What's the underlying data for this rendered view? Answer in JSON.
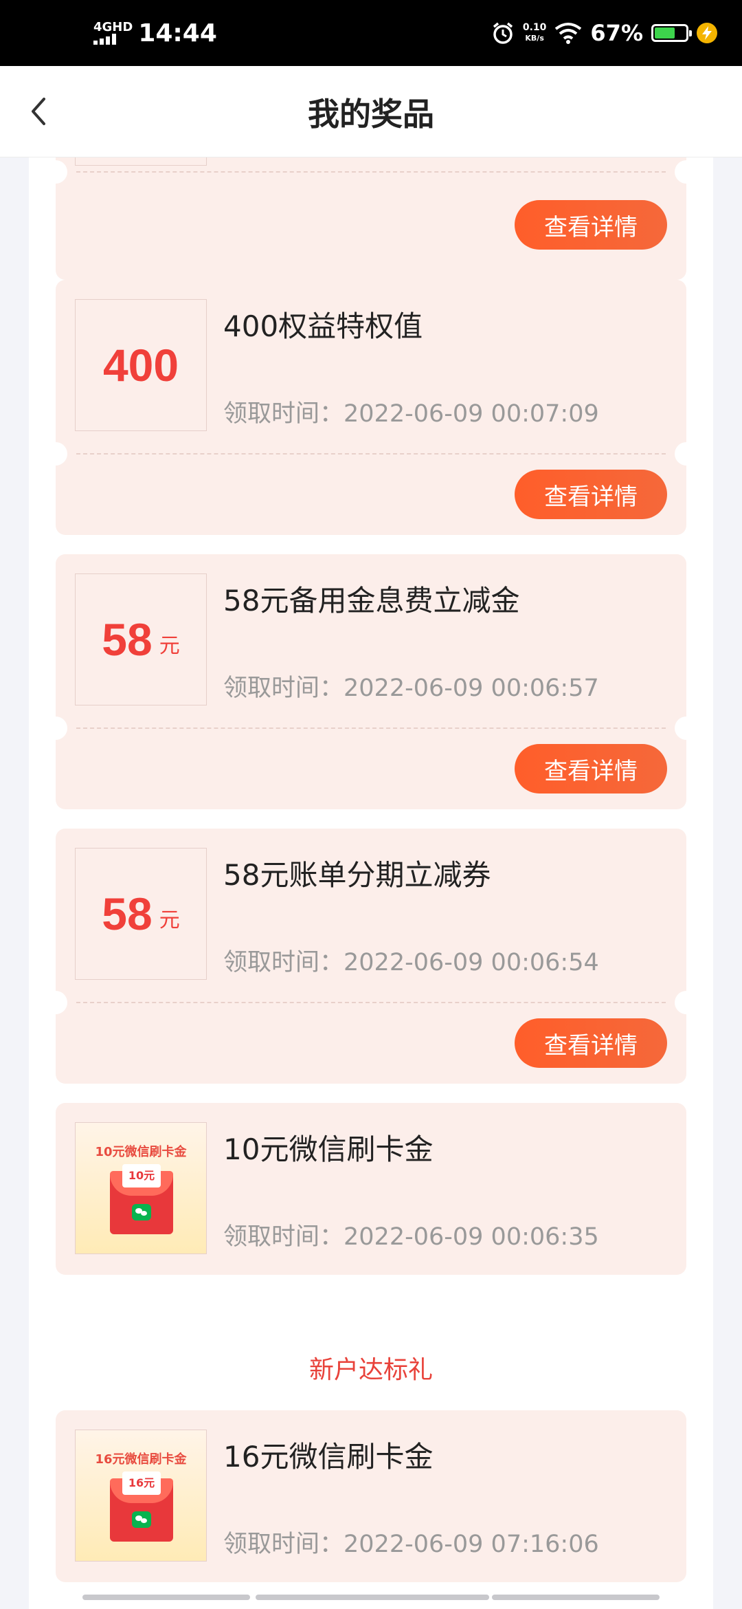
{
  "status": {
    "network": "4GHD",
    "time": "14:44",
    "speed_value": "0.10",
    "speed_unit": "KB/s",
    "battery_percent": "67%",
    "battery_level": 0.67
  },
  "nav": {
    "title": "我的奖品"
  },
  "prizes": [
    {
      "name": "400权益特权值",
      "amount": "400",
      "unit": "",
      "time_label": "领取时间：",
      "time": "2022-06-09 00:07:09",
      "button": "查看详情"
    },
    {
      "name": "58元备用金息费立减金",
      "amount": "58",
      "unit": "元",
      "time_label": "领取时间：",
      "time": "2022-06-09 00:06:57",
      "button": "查看详情"
    },
    {
      "name": "58元账单分期立减券",
      "amount": "58",
      "unit": "元",
      "time_label": "领取时间：",
      "time": "2022-06-09 00:06:54",
      "button": "查看详情"
    },
    {
      "name": "10元微信刷卡金",
      "image_title": "10元微信刷卡金",
      "image_amount": "10元",
      "time_label": "领取时间：",
      "time": "2022-06-09 00:06:35"
    }
  ],
  "partial_top_card": {
    "button": "查看详情"
  },
  "section2": {
    "title": "新户达标礼",
    "prizes": [
      {
        "name": "16元微信刷卡金",
        "image_title": "16元微信刷卡金",
        "image_amount": "16元",
        "time_label": "领取时间：",
        "time": "2022-06-09 07:16:06"
      }
    ]
  }
}
